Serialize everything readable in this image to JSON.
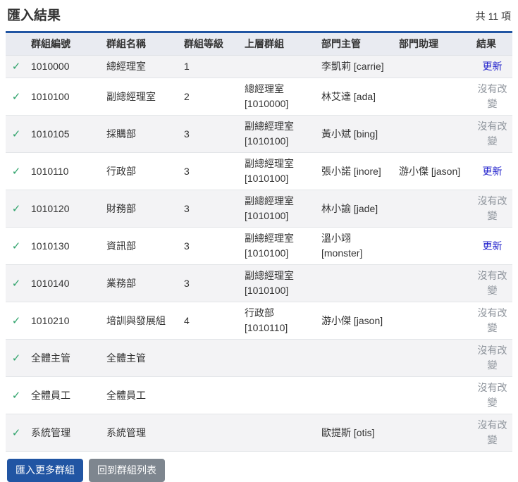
{
  "header": {
    "title": "匯入結果",
    "count": "共 11 項"
  },
  "table": {
    "columns": [
      "群組編號",
      "群組名稱",
      "群組等級",
      "上層群組",
      "部門主管",
      "部門助理",
      "結果"
    ],
    "rows": [
      {
        "code": "1010000",
        "name": "總經理室",
        "level": "1",
        "parent": "",
        "manager": "李凱莉 [carrie]",
        "assistant": "",
        "result": "更新",
        "result_style": "link"
      },
      {
        "code": "1010100",
        "name": "副總經理室",
        "level": "2",
        "parent": "總經理室 [1010000]",
        "manager": "林艾達 [ada]",
        "assistant": "",
        "result": "沒有改變",
        "result_style": "muted"
      },
      {
        "code": "1010105",
        "name": "採購部",
        "level": "3",
        "parent": "副總經理室 [1010100]",
        "manager": "黃小斌 [bing]",
        "assistant": "",
        "result": "沒有改變",
        "result_style": "muted"
      },
      {
        "code": "1010110",
        "name": "行政部",
        "level": "3",
        "parent": "副總經理室 [1010100]",
        "manager": "張小諾 [inore]",
        "assistant": "游小傑 [jason]",
        "result": "更新",
        "result_style": "link"
      },
      {
        "code": "1010120",
        "name": "財務部",
        "level": "3",
        "parent": "副總經理室 [1010100]",
        "manager": "林小諭 [jade]",
        "assistant": "",
        "result": "沒有改變",
        "result_style": "muted"
      },
      {
        "code": "1010130",
        "name": "資訊部",
        "level": "3",
        "parent": "副總經理室 [1010100]",
        "manager": "溫小翊 [monster]",
        "assistant": "",
        "result": "更新",
        "result_style": "link"
      },
      {
        "code": "1010140",
        "name": "業務部",
        "level": "3",
        "parent": "副總經理室 [1010100]",
        "manager": "",
        "assistant": "",
        "result": "沒有改變",
        "result_style": "muted"
      },
      {
        "code": "1010210",
        "name": "培訓與發展組",
        "level": "4",
        "parent": "行政部 [1010110]",
        "manager": "游小傑 [jason]",
        "assistant": "",
        "result": "沒有改變",
        "result_style": "muted"
      },
      {
        "code": "全體主管",
        "name": "全體主管",
        "level": "",
        "parent": "",
        "manager": "",
        "assistant": "",
        "result": "沒有改變",
        "result_style": "muted"
      },
      {
        "code": "全體員工",
        "name": "全體員工",
        "level": "",
        "parent": "",
        "manager": "",
        "assistant": "",
        "result": "沒有改變",
        "result_style": "muted"
      },
      {
        "code": "系統管理",
        "name": "系統管理",
        "level": "",
        "parent": "",
        "manager": "歐提斯 [otis]",
        "assistant": "",
        "result": "沒有改變",
        "result_style": "muted"
      }
    ],
    "status_icon_glyph": "✓",
    "status_icon_name": "check-icon"
  },
  "footer": {
    "import_more_label": "匯入更多群組",
    "back_to_list_label": "回到群組列表"
  },
  "colors": {
    "accent_blue": "#2155a3",
    "link_blue": "#2222cc",
    "muted_gray": "#8d939b",
    "check_green": "#2fa36b",
    "header_bg": "#e9ebf1",
    "stripe_bg": "#f3f3f5",
    "button_gray": "#7e868f"
  }
}
